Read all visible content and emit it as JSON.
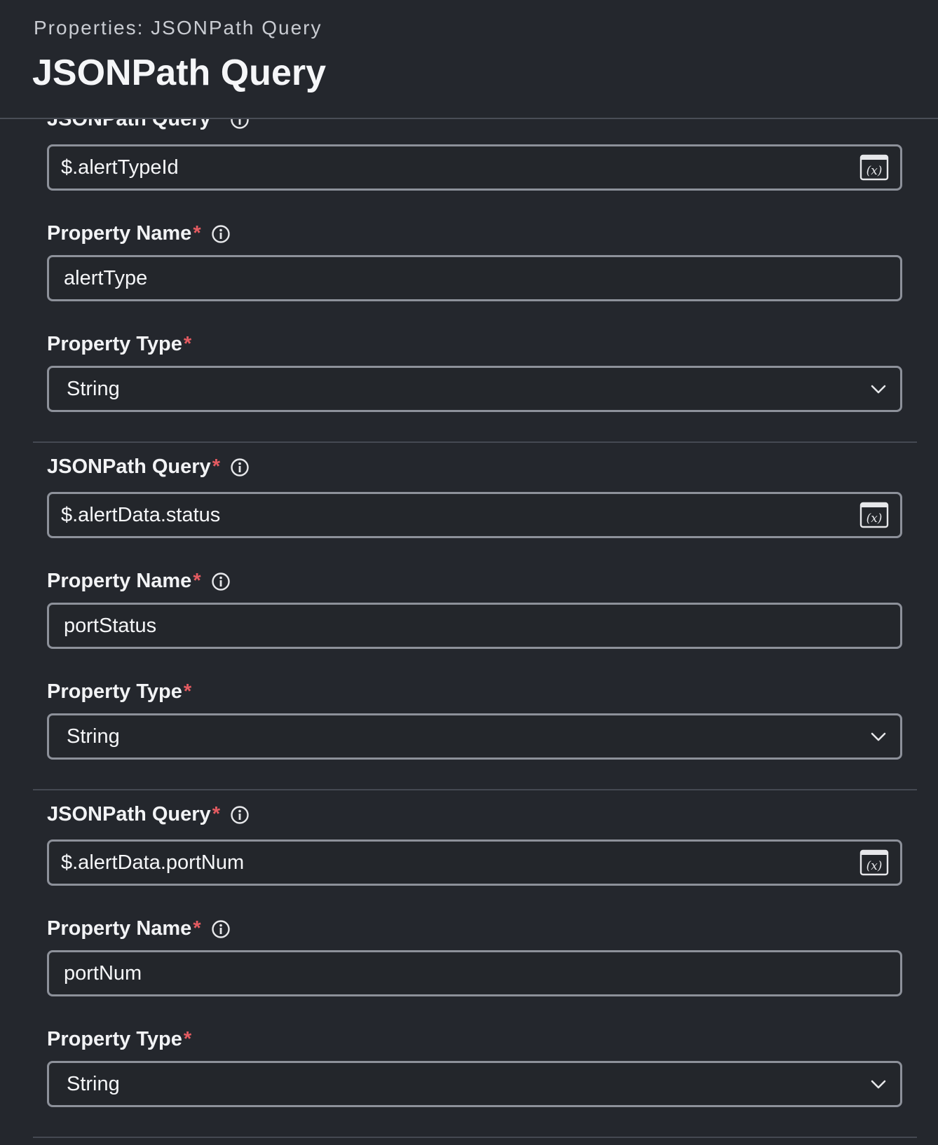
{
  "header": {
    "breadcrumb": "Properties: JSONPath Query",
    "title": "JSONPath Query"
  },
  "labels": {
    "query": "JSONPath Query",
    "name": "Property Name",
    "type": "Property Type",
    "required_mark": "*"
  },
  "groups": [
    {
      "query": "$.alertTypeId",
      "name": "alertType",
      "type": "String"
    },
    {
      "query": "$.alertData.status",
      "name": "portStatus",
      "type": "String"
    },
    {
      "query": "$.alertData.portNum",
      "name": "portNum",
      "type": "String"
    }
  ],
  "icons": {
    "info": "info-icon",
    "variable": "variable-icon",
    "dropdown": "chevron-down-icon"
  },
  "colors": {
    "background": "#24272d",
    "border": "#8d919a",
    "required": "#e45b61",
    "text": "#f2f3f5"
  }
}
